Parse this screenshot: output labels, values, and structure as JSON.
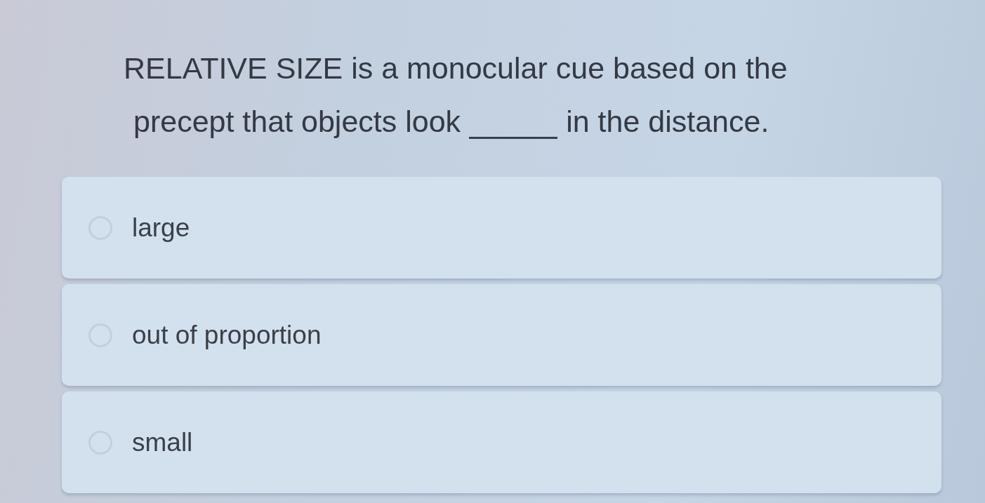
{
  "question": {
    "lines": [
      {
        "parts": [
          {
            "kind": "text",
            "text": "RELATIVE SIZE is a monocular cue based on the"
          }
        ]
      },
      {
        "parts": [
          {
            "kind": "text",
            "text": "precept that objects look"
          },
          {
            "kind": "blank"
          },
          {
            "kind": "text",
            "text": "in the distance."
          }
        ]
      }
    ]
  },
  "options": [
    {
      "label": "large",
      "selected": false
    },
    {
      "label": "out of proportion",
      "selected": false
    },
    {
      "label": "small",
      "selected": false
    }
  ]
}
